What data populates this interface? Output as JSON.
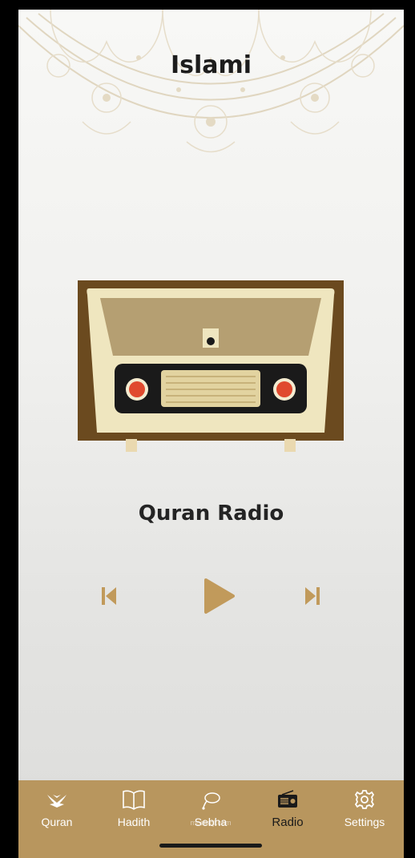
{
  "app": {
    "title": "Islami"
  },
  "player": {
    "station_name": "Quran Radio",
    "controls": {
      "previous_icon": "skip-previous-icon",
      "play_icon": "play-icon",
      "next_icon": "skip-next-icon"
    }
  },
  "bottom_nav": {
    "active": "Radio",
    "items": [
      {
        "label": "Quran",
        "icon": "quran-icon"
      },
      {
        "label": "Hadith",
        "icon": "book-open-icon"
      },
      {
        "label": "Sebha",
        "icon": "sebha-icon"
      },
      {
        "label": "Radio",
        "icon": "radio-icon"
      },
      {
        "label": "Settings",
        "icon": "gear-icon"
      }
    ]
  },
  "watermark": {
    "text": "mostaql.com"
  },
  "colors": {
    "accent": "#b8965e",
    "radio_wood": "#6b4a1f",
    "radio_frame": "#e8dfb6",
    "knob_red": "#e04a2e"
  }
}
